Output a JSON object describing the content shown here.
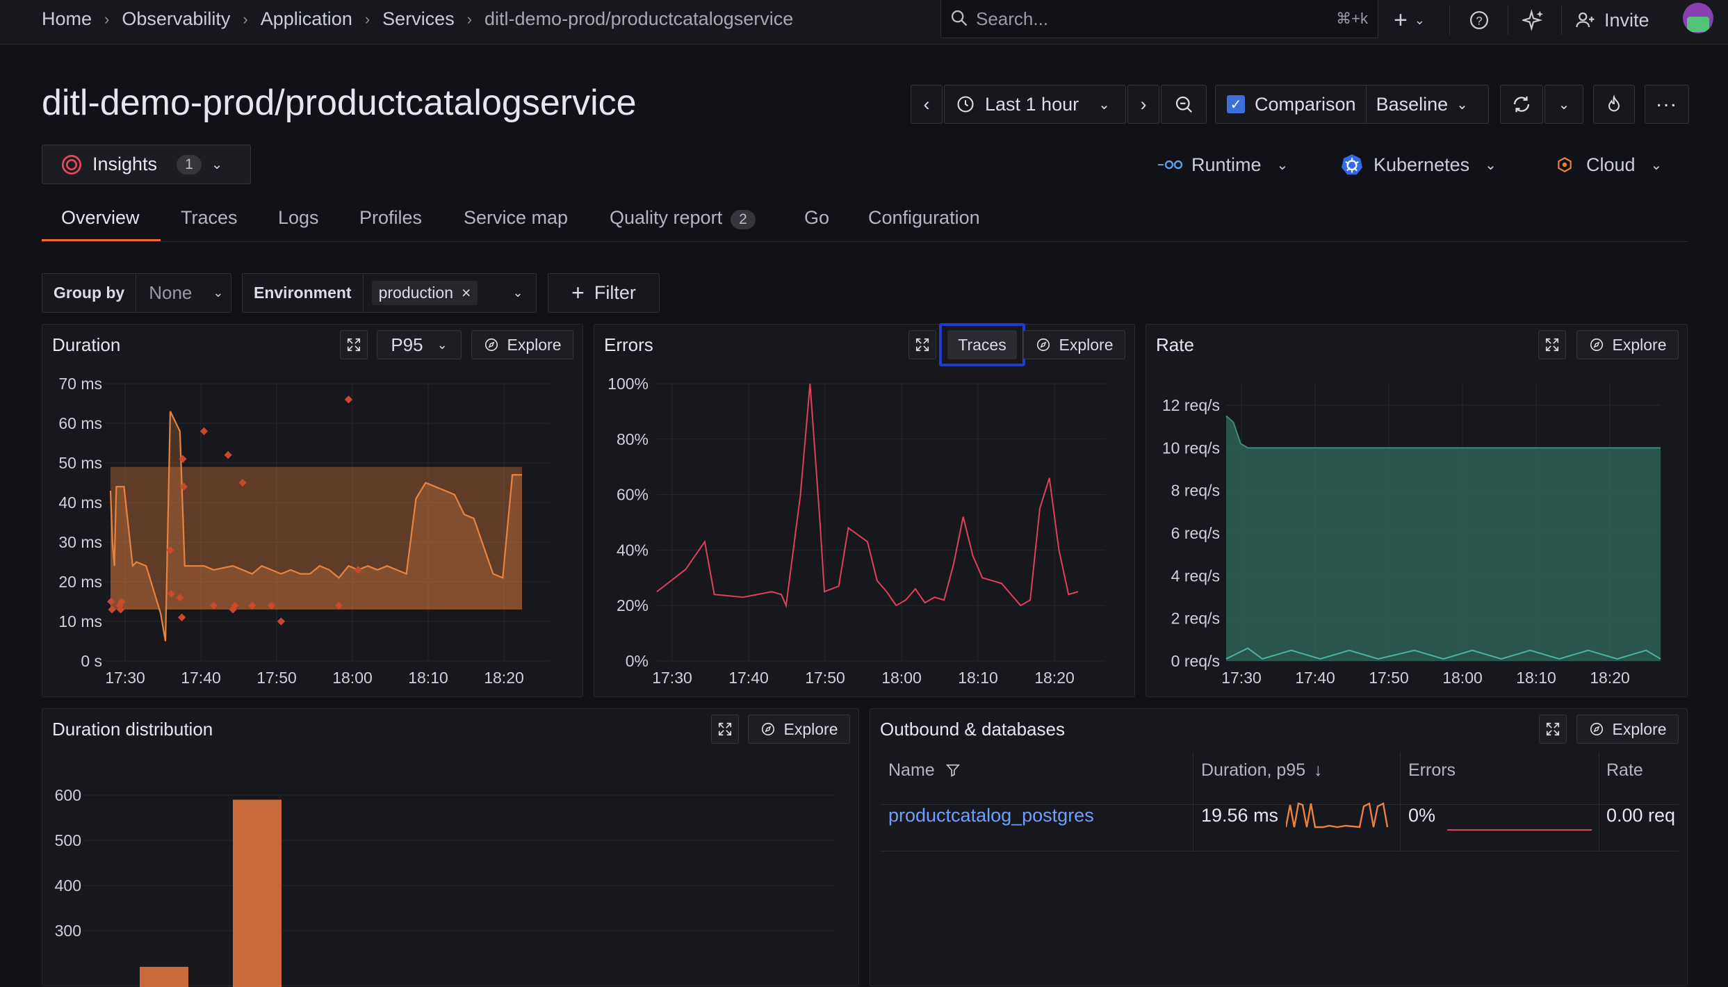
{
  "breadcrumbs": [
    "Home",
    "Observability",
    "Application",
    "Services",
    "ditl-demo-prod/productcatalogservice"
  ],
  "search": {
    "placeholder": "Search...",
    "shortcut": "⌘+k"
  },
  "topbar": {
    "invite": "Invite"
  },
  "page_title": "ditl-demo-prod/productcatalogservice",
  "time_picker": {
    "label": "Last 1 hour"
  },
  "comparison": {
    "label": "Comparison",
    "checked": true,
    "mode": "Baseline"
  },
  "insights": {
    "label": "Insights",
    "count": "1"
  },
  "context": {
    "runtime": "Runtime",
    "kubernetes": "Kubernetes",
    "cloud": "Cloud"
  },
  "tabs": [
    {
      "label": "Overview",
      "active": true
    },
    {
      "label": "Traces"
    },
    {
      "label": "Logs"
    },
    {
      "label": "Profiles"
    },
    {
      "label": "Service map"
    },
    {
      "label": "Quality report",
      "badge": "2"
    },
    {
      "label": "Go"
    },
    {
      "label": "Configuration"
    }
  ],
  "filters": {
    "group_by_label": "Group by",
    "group_by_value": "None",
    "env_label": "Environment",
    "env_value": "production",
    "add_filter": "Filter"
  },
  "panels": {
    "duration": {
      "title": "Duration",
      "stat": "P95",
      "explore": "Explore"
    },
    "errors": {
      "title": "Errors",
      "traces": "Traces",
      "explore": "Explore"
    },
    "rate": {
      "title": "Rate",
      "explore": "Explore"
    },
    "distribution": {
      "title": "Duration distribution",
      "explore": "Explore"
    },
    "outbound": {
      "title": "Outbound & databases",
      "explore": "Explore",
      "columns": [
        "Name",
        "Duration, p95",
        "Errors",
        "Rate"
      ],
      "rows": [
        {
          "name": "productcatalog_postgres",
          "duration": "19.56 ms",
          "errors": "0%",
          "rate": "0.00 req"
        }
      ]
    }
  },
  "colors": {
    "accent": "#f2673a",
    "duration": "#e8823f",
    "errors": "#e0405a",
    "rate": "#3f8a7a",
    "link": "#6e9fff",
    "highlight": "#1f3ccf"
  },
  "chart_data": [
    {
      "type": "line",
      "name": "Duration",
      "x_ticks": [
        "17:30",
        "17:40",
        "17:50",
        "18:00",
        "18:10",
        "18:20"
      ],
      "y_ticks": [
        "0 s",
        "10 ms",
        "20 ms",
        "30 ms",
        "40 ms",
        "50 ms",
        "60 ms",
        "70 ms"
      ],
      "ylim": [
        0,
        70
      ],
      "line": [
        [
          17.0,
          43
        ],
        [
          17.4,
          30
        ],
        [
          17.8,
          24
        ],
        [
          18.2,
          44
        ],
        [
          19.8,
          44
        ],
        [
          21.6,
          24
        ],
        [
          22.4,
          25
        ],
        [
          24.4,
          24
        ],
        [
          27.4,
          12
        ],
        [
          28.4,
          5
        ],
        [
          29.4,
          63
        ],
        [
          31.4,
          58
        ],
        [
          32.4,
          24
        ],
        [
          36.4,
          24
        ],
        [
          38.4,
          23
        ],
        [
          42.4,
          24
        ],
        [
          46.4,
          22
        ],
        [
          48.4,
          24
        ],
        [
          50.4,
          23
        ],
        [
          52.4,
          22
        ],
        [
          54.4,
          23
        ],
        [
          56.4,
          22
        ],
        [
          58.4,
          22
        ],
        [
          60.4,
          24
        ],
        [
          62.4,
          23
        ],
        [
          64.4,
          21
        ],
        [
          66.4,
          24
        ],
        [
          68.4,
          23
        ],
        [
          70.4,
          24
        ],
        [
          72.4,
          23
        ],
        [
          74.4,
          24
        ],
        [
          76.4,
          23
        ],
        [
          78.4,
          22
        ],
        [
          80.4,
          41
        ],
        [
          82.4,
          45
        ],
        [
          84.4,
          44
        ],
        [
          88.4,
          42
        ],
        [
          90.4,
          37
        ],
        [
          92.4,
          36
        ],
        [
          96.4,
          22
        ],
        [
          98.4,
          21
        ],
        [
          100.4,
          47
        ],
        [
          102.4,
          47
        ]
      ],
      "baseline_band": {
        "lower": 13,
        "upper": 49
      },
      "outliers": [
        [
          17.1,
          15
        ],
        [
          17.3,
          13
        ],
        [
          18.9,
          14
        ],
        [
          19.1,
          13
        ],
        [
          19.3,
          15
        ],
        [
          29.4,
          28
        ],
        [
          29.6,
          17
        ],
        [
          31.4,
          16
        ],
        [
          31.8,
          11
        ],
        [
          32.0,
          51
        ],
        [
          32.2,
          44
        ],
        [
          36.4,
          58
        ],
        [
          38.4,
          14
        ],
        [
          41.4,
          52
        ],
        [
          42.4,
          13
        ],
        [
          42.8,
          14
        ],
        [
          44.4,
          45
        ],
        [
          46.4,
          14
        ],
        [
          50.4,
          14
        ],
        [
          52.4,
          10
        ],
        [
          64.4,
          14
        ],
        [
          66.4,
          66
        ],
        [
          68.4,
          23
        ]
      ]
    },
    {
      "type": "line",
      "name": "Errors",
      "x_ticks": [
        "17:30",
        "17:40",
        "17:50",
        "18:00",
        "18:10",
        "18:20"
      ],
      "y_ticks": [
        "0%",
        "20%",
        "40%",
        "60%",
        "80%",
        "100%"
      ],
      "ylim": [
        0,
        100
      ],
      "line": [
        [
          0,
          25
        ],
        [
          3,
          33
        ],
        [
          5,
          43
        ],
        [
          6,
          24
        ],
        [
          9,
          23
        ],
        [
          12,
          25
        ],
        [
          13,
          24
        ],
        [
          13.5,
          20
        ],
        [
          15,
          60
        ],
        [
          16,
          100
        ],
        [
          17,
          52
        ],
        [
          17.5,
          25
        ],
        [
          19,
          27
        ],
        [
          20,
          48
        ],
        [
          22,
          43
        ],
        [
          23,
          29
        ],
        [
          24,
          25
        ],
        [
          25,
          20
        ],
        [
          26,
          22
        ],
        [
          27,
          26
        ],
        [
          28,
          21
        ],
        [
          29,
          23
        ],
        [
          30,
          22
        ],
        [
          31,
          35
        ],
        [
          32,
          52
        ],
        [
          33,
          38
        ],
        [
          34,
          30
        ],
        [
          35,
          29
        ],
        [
          36,
          28
        ],
        [
          37,
          24
        ],
        [
          38,
          20
        ],
        [
          39,
          22
        ],
        [
          40,
          55
        ],
        [
          41,
          66
        ],
        [
          42,
          40
        ],
        [
          43,
          24
        ],
        [
          44,
          25
        ]
      ],
      "x_range": [
        0,
        44
      ]
    },
    {
      "type": "area",
      "name": "Rate",
      "x_ticks": [
        "17:30",
        "17:40",
        "17:50",
        "18:00",
        "18:10",
        "18:20"
      ],
      "y_ticks": [
        "0 req/s",
        "2 req/s",
        "4 req/s",
        "6 req/s",
        "8 req/s",
        "10 req/s",
        "12 req/s"
      ],
      "ylim": [
        0,
        13
      ],
      "total": [
        [
          0,
          11.5
        ],
        [
          1,
          11.2
        ],
        [
          2,
          10.2
        ],
        [
          3,
          10.0
        ],
        [
          60,
          10.0
        ]
      ],
      "errors_line": [
        [
          0,
          0.1
        ],
        [
          3,
          0.6
        ],
        [
          5,
          0.1
        ],
        [
          9,
          0.5
        ],
        [
          13,
          0.1
        ],
        [
          17,
          0.5
        ],
        [
          21,
          0.1
        ],
        [
          26,
          0.5
        ],
        [
          30,
          0.1
        ],
        [
          34,
          0.5
        ],
        [
          38,
          0.1
        ],
        [
          42,
          0.5
        ],
        [
          46,
          0.1
        ],
        [
          50,
          0.5
        ],
        [
          54,
          0.1
        ],
        [
          58,
          0.5
        ],
        [
          60,
          0.1
        ]
      ]
    },
    {
      "type": "bar",
      "name": "Duration distribution",
      "y_ticks": [
        "300",
        "400",
        "500",
        "600"
      ],
      "ylim": [
        200,
        650
      ],
      "values": [
        {
          "bin": 1,
          "count": 220
        },
        {
          "bin": 2,
          "count": 590
        }
      ]
    }
  ]
}
